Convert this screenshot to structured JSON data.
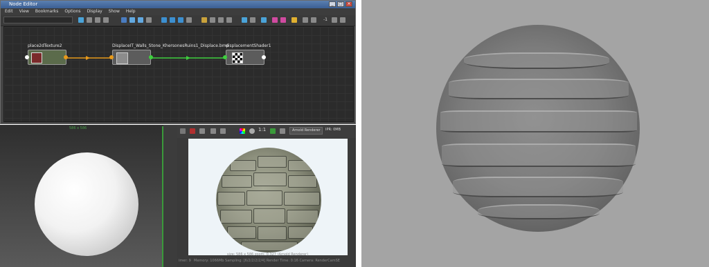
{
  "node_editor": {
    "title": "Node Editor",
    "menu": [
      "Edit",
      "View",
      "Bookmarks",
      "Options",
      "Display",
      "Show",
      "Help"
    ],
    "toolbar_value": "-1",
    "nodes": [
      {
        "label": "place2dTexture2"
      },
      {
        "label": "DisplaceIT_Walls_Stone_KhersonesRuins1_Displace.bmp"
      },
      {
        "label": "displacementShader1"
      }
    ]
  },
  "viewport": {
    "label": "586 x 586"
  },
  "render_view": {
    "ratio": "1:1",
    "renderer": "Arnold Renderer",
    "ipr": "IPR: 0MB",
    "status_line1": "size: 586 x 586  zoom: 0.327    (Arnold Renderer)",
    "status_line2": "Memory: 1066Mb    Sampling: [6/2/2/2/2/4]    Render Time: 0:16    Camera: RenderCamSE",
    "status_side": "imer: 9"
  },
  "colors": {
    "graph_bg": "#2b2b2b",
    "connection_orange": "#e89a1a",
    "connection_green": "#3ecf3e",
    "viewport_green": "#3a9a3a",
    "right_bg": "#a4a4a4"
  }
}
